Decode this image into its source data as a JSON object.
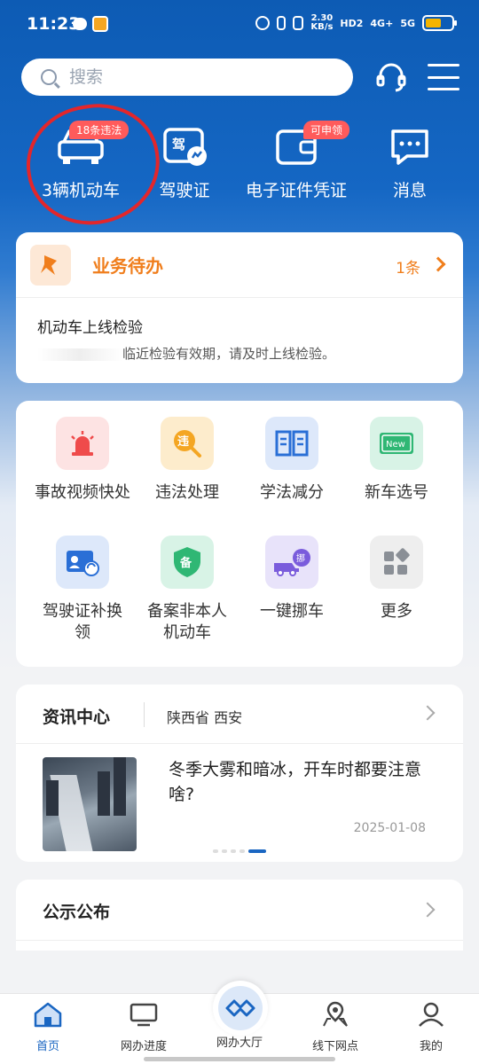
{
  "status_bar": {
    "time": "11:23",
    "speed": "2.30\nKB/s",
    "network": "4G+",
    "network2": "5G",
    "hd": "HD2"
  },
  "search": {
    "placeholder": "搜索"
  },
  "quick": {
    "vehicles": {
      "label": "3辆机动车",
      "badge": "18条违法"
    },
    "license": {
      "label": "驾驶证",
      "icon_text": "驾"
    },
    "e_cert": {
      "label": "电子证件凭证",
      "badge": "可申领"
    },
    "messages": {
      "label": "消息"
    }
  },
  "todo": {
    "title": "业务待办",
    "count": "1条",
    "item_title": "机动车上线检验",
    "item_desc": "临近检验有效期，请及时上线检验。"
  },
  "services": [
    {
      "label": "事故视频快处",
      "icon": "alarm-icon",
      "color": "#fde3e3"
    },
    {
      "label": "违法处理",
      "icon": "violation-search-icon",
      "color": "#fdeccc",
      "icon_text": "违"
    },
    {
      "label": "学法减分",
      "icon": "book-icon",
      "color": "#dde8fa"
    },
    {
      "label": "新车选号",
      "icon": "new-plate-icon",
      "color": "#d8f3e6",
      "icon_text": "New"
    },
    {
      "label": "驾驶证补换领",
      "icon": "license-renew-icon",
      "color": "#dde8fa"
    },
    {
      "label": "备案非本人机动车",
      "icon": "shield-icon",
      "color": "#d8f3e6",
      "icon_text": "备"
    },
    {
      "label": "一键挪车",
      "icon": "move-car-icon",
      "color": "#e8e3fa",
      "icon_text": "挪"
    },
    {
      "label": "更多",
      "icon": "more-grid-icon",
      "color": "#eeeeee"
    }
  ],
  "news": {
    "title": "资讯中心",
    "region": "陕西省 西安",
    "headline": "冬季大雾和暗冰，开车时都要注意啥?",
    "date": "2025-01-08"
  },
  "notice": {
    "title": "公示公布"
  },
  "tabbar": [
    {
      "label": "首页",
      "icon": "home-icon"
    },
    {
      "label": "网办进度",
      "icon": "progress-icon"
    },
    {
      "label": "网办大厅",
      "icon": "hall-icon"
    },
    {
      "label": "线下网点",
      "icon": "location-icon"
    },
    {
      "label": "我的",
      "icon": "profile-icon"
    }
  ],
  "colors": {
    "brand_blue": "#1a66c2",
    "accent_orange": "#f07e1c",
    "badge_red": "#ff5b5b"
  }
}
